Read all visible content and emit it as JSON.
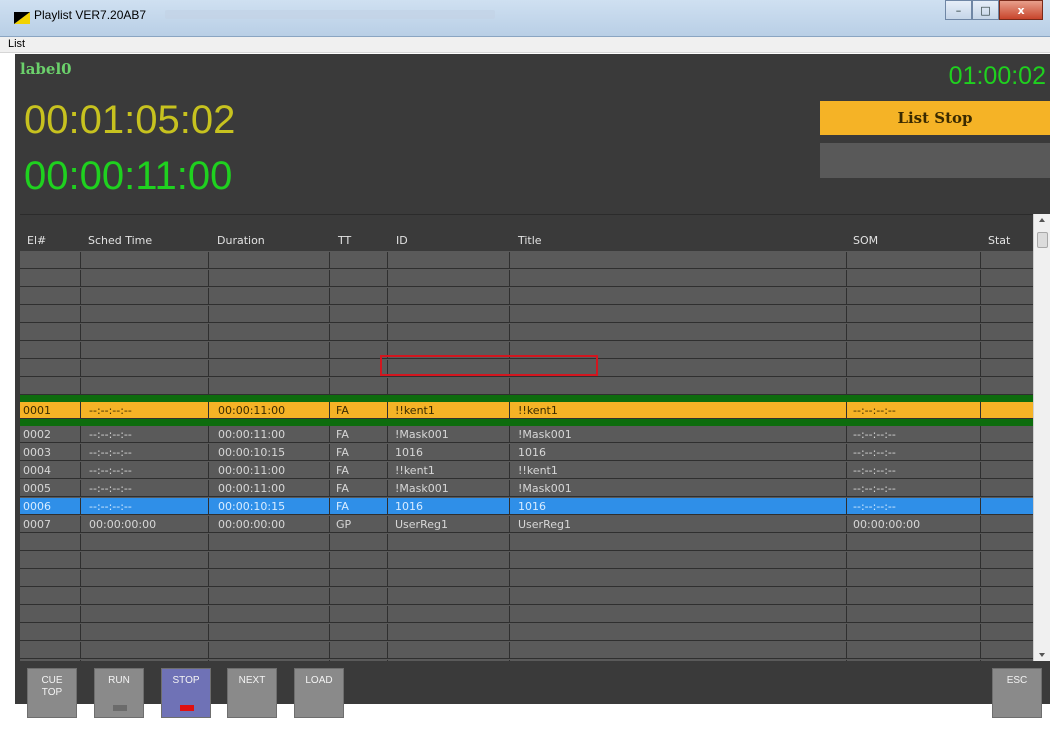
{
  "window": {
    "title": "Playlist VER7.20AB7",
    "min_symbol": "–",
    "max_symbol": "□",
    "close_symbol": "x"
  },
  "menu": {
    "list": "List"
  },
  "header": {
    "label0": "label0",
    "clock": "01:00:02",
    "timer_main": "00:01:05:02",
    "timer_remaining": "00:00:11:00",
    "list_status": "List Stop"
  },
  "columns": [
    "El#",
    "Sched Time",
    "Duration",
    "TT",
    "ID",
    "Title",
    "SOM",
    "Stat"
  ],
  "rows": [
    {
      "el": "0001",
      "sched": "--:--:--:--",
      "duration": "00:00:11:00",
      "tt": "FA",
      "id": "!!kent1",
      "title": "!!kent1",
      "som": "--:--:--:--",
      "state": "current"
    },
    {
      "el": "0002",
      "sched": "--:--:--:--",
      "duration": "00:00:11:00",
      "tt": "FA",
      "id": "!Mask001",
      "title": "!Mask001",
      "som": "--:--:--:--",
      "state": "normal"
    },
    {
      "el": "0003",
      "sched": "--:--:--:--",
      "duration": "00:00:10:15",
      "tt": "FA",
      "id": "1016",
      "title": "1016",
      "som": "--:--:--:--",
      "state": "normal"
    },
    {
      "el": "0004",
      "sched": "--:--:--:--",
      "duration": "00:00:11:00",
      "tt": "FA",
      "id": "!!kent1",
      "title": "!!kent1",
      "som": "--:--:--:--",
      "state": "normal"
    },
    {
      "el": "0005",
      "sched": "--:--:--:--",
      "duration": "00:00:11:00",
      "tt": "FA",
      "id": "!Mask001",
      "title": "!Mask001",
      "som": "--:--:--:--",
      "state": "normal"
    },
    {
      "el": "0006",
      "sched": "--:--:--:--",
      "duration": "00:00:10:15",
      "tt": "FA",
      "id": "1016",
      "title": "1016",
      "som": "--:--:--:--",
      "state": "selected"
    },
    {
      "el": "0007",
      "sched": "00:00:00:00",
      "duration": "00:00:00:00",
      "tt": "GP",
      "id": "UserReg1",
      "title": "UserReg1",
      "som": "00:00:00:00",
      "state": "normal"
    }
  ],
  "buttons": {
    "cue_top_1": "CUE",
    "cue_top_2": "TOP",
    "run": "RUN",
    "stop": "STOP",
    "next": "NEXT",
    "load": "LOAD",
    "esc": "ESC"
  },
  "colors": {
    "current_row": "#f5b326",
    "selected_row": "#2f8fe8",
    "list_stop_bg": "#f5b326",
    "clock_green": "#1fd11f",
    "timer_yellow": "#c7c21f",
    "stop_indicator": "#e01010",
    "highlight_border": "#d2161f"
  }
}
